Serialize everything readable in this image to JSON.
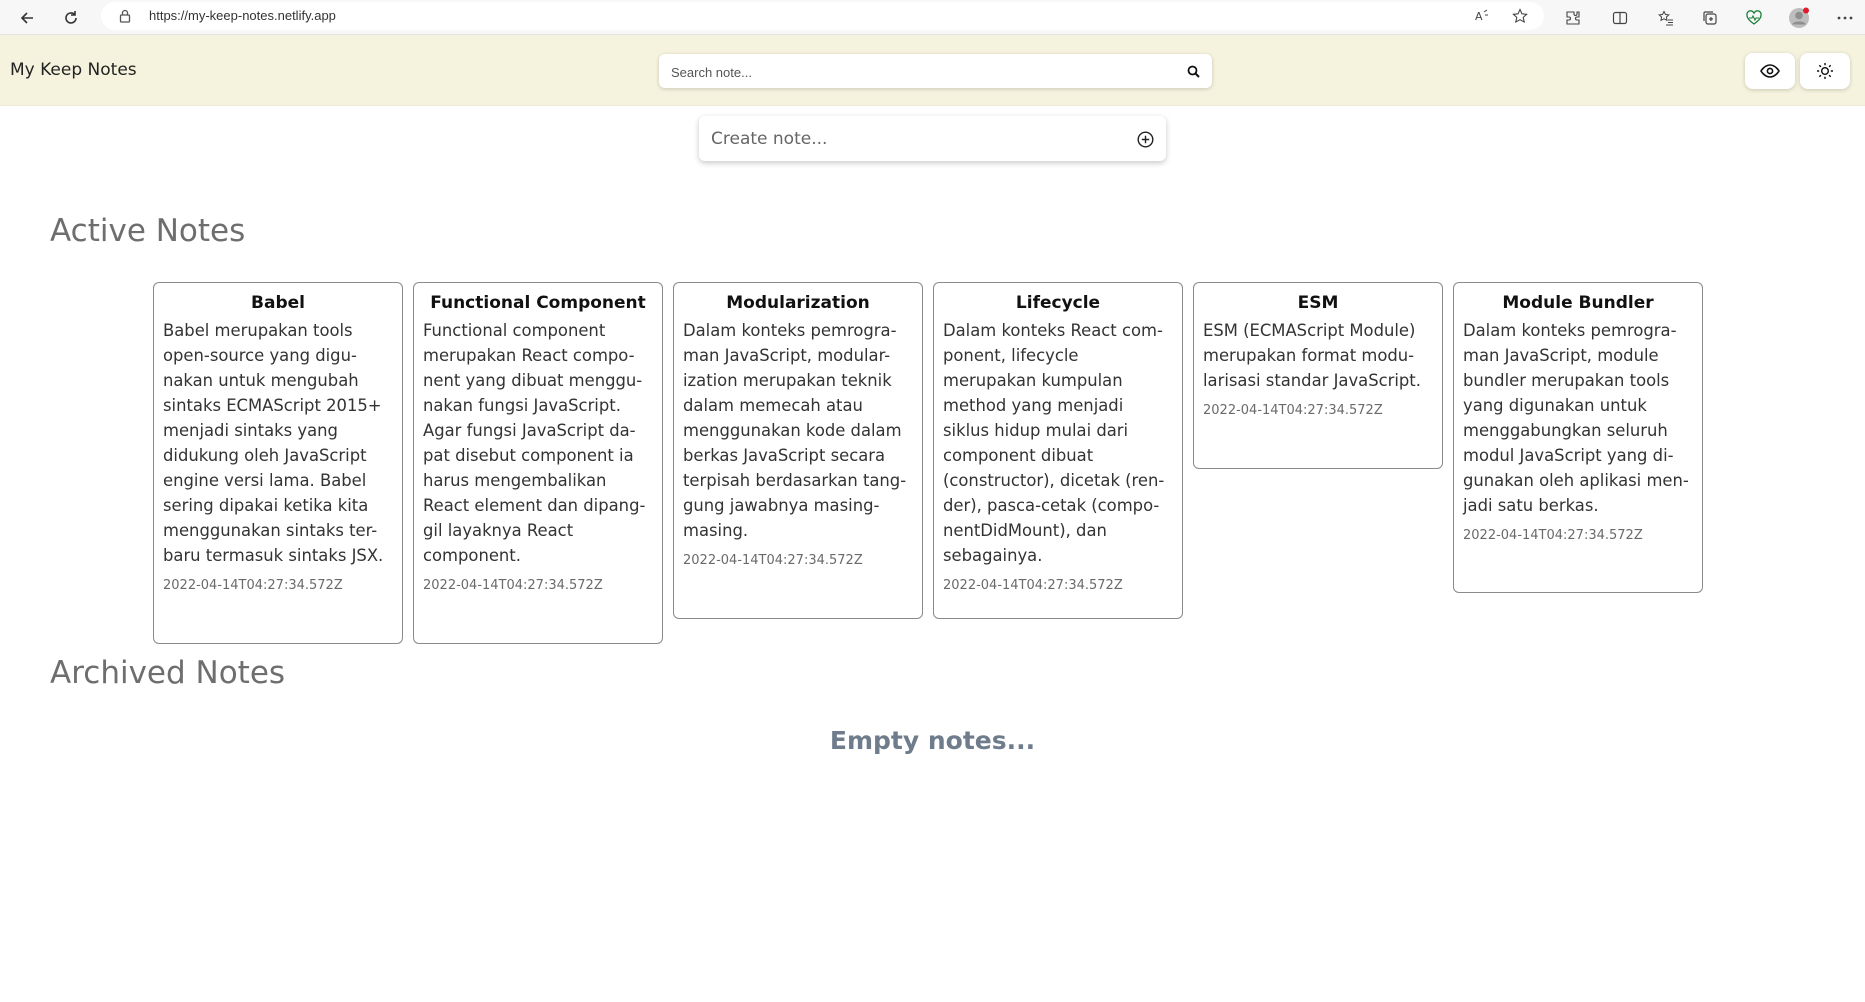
{
  "browser": {
    "url": "https://my-keep-notes.netlify.app"
  },
  "header": {
    "title": "My Keep Notes",
    "search_placeholder": "Search note..."
  },
  "create": {
    "placeholder": "Create note..."
  },
  "sections": {
    "active_title": "Active Notes",
    "archived_title": "Archived Notes",
    "empty_text": "Empty notes..."
  },
  "notes": [
    {
      "title": "Babel",
      "body": "Babel merupakan tools open-source yang digu-nakan untuk mengubah sintaks ECMAScript 2015+ menjadi sintaks yang didukung oleh JavaScript engine versi lama. Babel sering dipakai ketika kita menggunakan sintaks ter-baru termasuk sintaks JSX.",
      "date": "2022-04-14T04:27:34.572Z"
    },
    {
      "title": "Functional Component",
      "body": "Functional component merupakan React compo-nent yang dibuat menggu-nakan fungsi JavaScript. Agar fungsi JavaScript da-pat disebut component ia harus mengembalikan React element dan dipang-gil layaknya React component.",
      "date": "2022-04-14T04:27:34.572Z"
    },
    {
      "title": "Modularization",
      "body": "Dalam konteks pemrogra-man JavaScript, modular-ization merupakan teknik dalam memecah atau menggunakan kode dalam berkas JavaScript secara terpisah berdasarkan tang-gung jawabnya masing-masing.",
      "date": "2022-04-14T04:27:34.572Z"
    },
    {
      "title": "Lifecycle",
      "body": "Dalam konteks React com-ponent, lifecycle merupakan kumpulan method yang menjadi siklus hidup mulai dari component dibuat (constructor), dicetak (ren-der), pasca-cetak (compo-nentDidMount), dan sebagainya.",
      "date": "2022-04-14T04:27:34.572Z"
    },
    {
      "title": "ESM",
      "body": "ESM (ECMAScript Module) merupakan format modu-larisasi standar JavaScript.",
      "date": "2022-04-14T04:27:34.572Z"
    },
    {
      "title": "Module Bundler",
      "body": "Dalam konteks pemrogra-man JavaScript, module bundler merupakan tools yang digunakan untuk menggabungkan seluruh modul JavaScript yang di-gunakan oleh aplikasi men-jadi satu berkas.",
      "date": "2022-04-14T04:27:34.572Z"
    }
  ]
}
